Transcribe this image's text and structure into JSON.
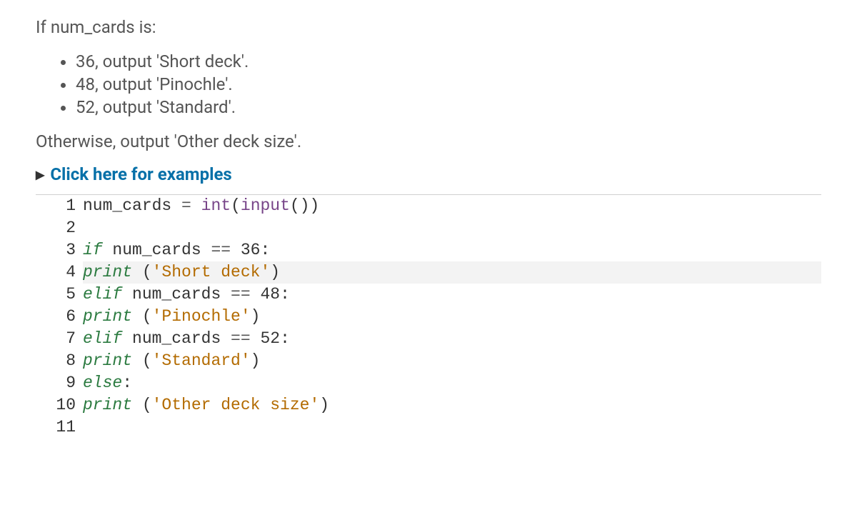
{
  "intro": "If num_cards is:",
  "conditions": [
    "36, output 'Short deck'.",
    "48, output 'Pinochle'.",
    "52, output 'Standard'."
  ],
  "otherwise": "Otherwise, output 'Other deck size'.",
  "examples_link": "Click here for examples",
  "code": {
    "highlighted_line": 4,
    "lines": [
      {
        "n": 1,
        "tokens": [
          [
            "plain",
            "num_cards "
          ],
          [
            "op",
            "="
          ],
          [
            "plain",
            " "
          ],
          [
            "bi",
            "int"
          ],
          [
            "plain",
            "("
          ],
          [
            "bi",
            "input"
          ],
          [
            "plain",
            "())"
          ]
        ]
      },
      {
        "n": 2,
        "tokens": [
          [
            "plain",
            ""
          ]
        ]
      },
      {
        "n": 3,
        "tokens": [
          [
            "kw",
            "if"
          ],
          [
            "plain",
            " num_cards "
          ],
          [
            "op",
            "=="
          ],
          [
            "plain",
            " "
          ],
          [
            "num",
            "36"
          ],
          [
            "plain",
            ":"
          ]
        ]
      },
      {
        "n": 4,
        "tokens": [
          [
            "kw",
            "print"
          ],
          [
            "plain",
            " ("
          ],
          [
            "str",
            "'Short deck'"
          ],
          [
            "plain",
            ")"
          ]
        ]
      },
      {
        "n": 5,
        "tokens": [
          [
            "kw",
            "elif"
          ],
          [
            "plain",
            " num_cards "
          ],
          [
            "op",
            "=="
          ],
          [
            "plain",
            " "
          ],
          [
            "num",
            "48"
          ],
          [
            "plain",
            ":"
          ]
        ]
      },
      {
        "n": 6,
        "tokens": [
          [
            "kw",
            "print"
          ],
          [
            "plain",
            " ("
          ],
          [
            "str",
            "'Pinochle'"
          ],
          [
            "plain",
            ")"
          ]
        ]
      },
      {
        "n": 7,
        "tokens": [
          [
            "kw",
            "elif"
          ],
          [
            "plain",
            " num_cards "
          ],
          [
            "op",
            "=="
          ],
          [
            "plain",
            " "
          ],
          [
            "num",
            "52"
          ],
          [
            "plain",
            ":"
          ]
        ]
      },
      {
        "n": 8,
        "tokens": [
          [
            "kw",
            "print"
          ],
          [
            "plain",
            " ("
          ],
          [
            "str",
            "'Standard'"
          ],
          [
            "plain",
            ")"
          ]
        ]
      },
      {
        "n": 9,
        "tokens": [
          [
            "kw",
            "else"
          ],
          [
            "plain",
            ":"
          ]
        ]
      },
      {
        "n": 10,
        "tokens": [
          [
            "kw",
            "print"
          ],
          [
            "plain",
            " ("
          ],
          [
            "str",
            "'Other deck size'"
          ],
          [
            "plain",
            ")"
          ]
        ]
      },
      {
        "n": 11,
        "tokens": [
          [
            "plain",
            ""
          ]
        ]
      }
    ]
  }
}
